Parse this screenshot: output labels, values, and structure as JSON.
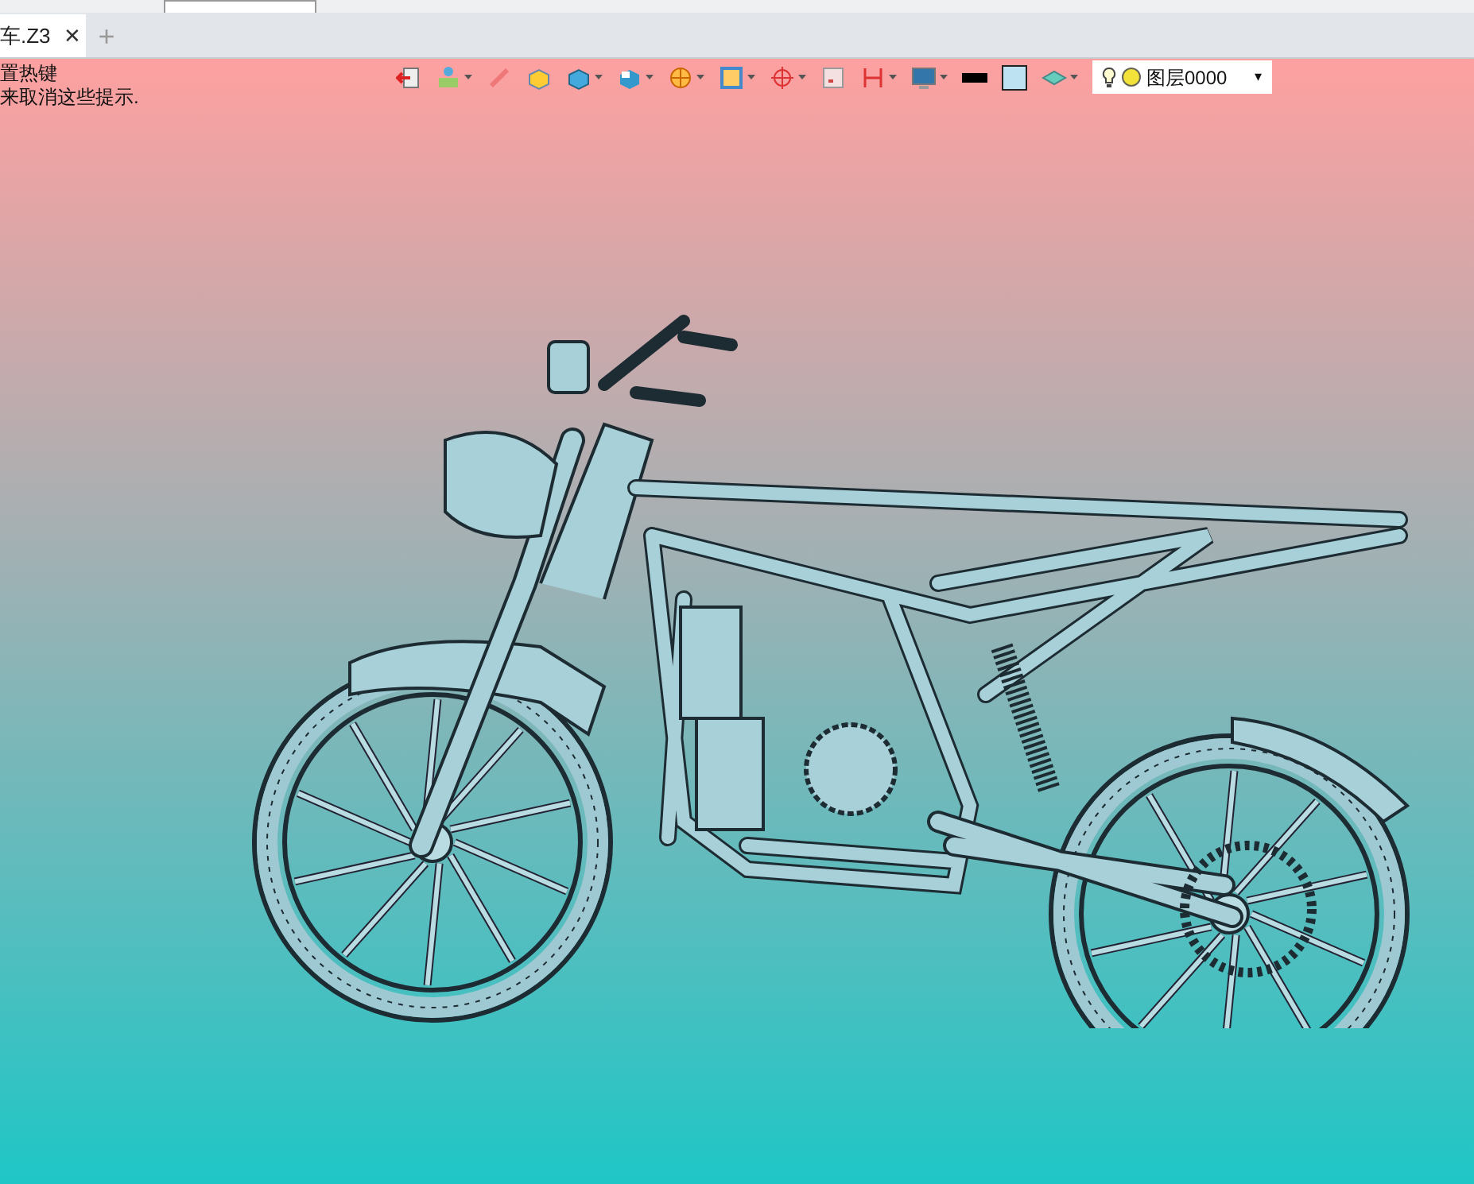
{
  "tab": {
    "title": "车.Z3",
    "close": "✕",
    "selected": true
  },
  "new_tab": "+",
  "hint_lines": [
    "置热键",
    "来取消这些提示."
  ],
  "layer": {
    "name": "图层0000",
    "caret": "▾"
  }
}
